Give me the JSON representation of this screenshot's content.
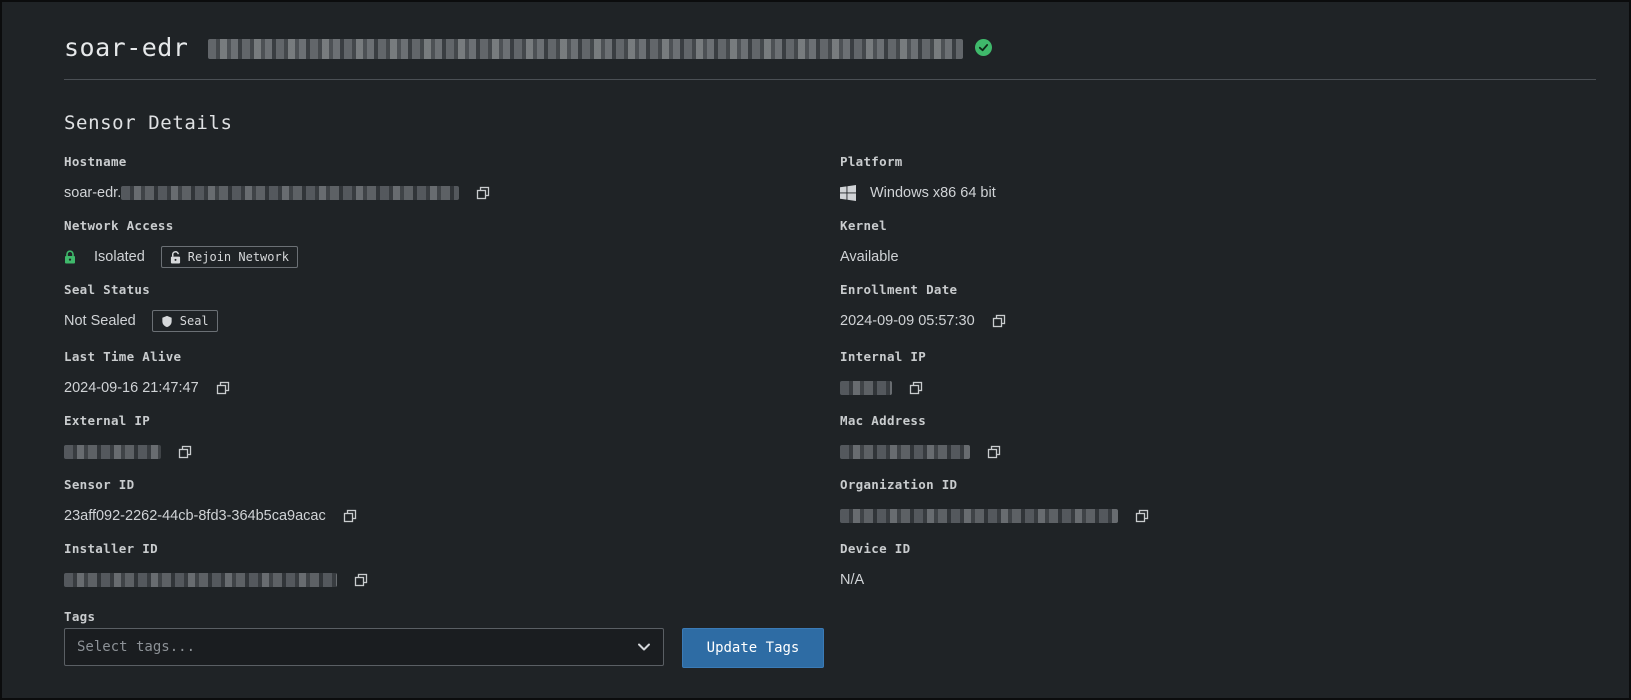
{
  "header": {
    "title_prefix": "soar-edr",
    "status": "online"
  },
  "section": {
    "title": "Sensor Details"
  },
  "left_fields": {
    "hostname": {
      "label": "Hostname",
      "value_prefix": "soar-edr."
    },
    "network_access": {
      "label": "Network Access",
      "value": "Isolated",
      "button_label": "Rejoin Network"
    },
    "seal_status": {
      "label": "Seal Status",
      "value": "Not Sealed",
      "button_label": "Seal"
    },
    "last_time_alive": {
      "label": "Last Time Alive",
      "value": "2024-09-16 21:47:47"
    },
    "external_ip": {
      "label": "External IP"
    },
    "sensor_id": {
      "label": "Sensor ID",
      "value": "23aff092-2262-44cb-8fd3-364b5ca9acac"
    },
    "installer_id": {
      "label": "Installer ID"
    }
  },
  "right_fields": {
    "platform": {
      "label": "Platform",
      "value": "Windows x86 64 bit",
      "icon": "windows-icon"
    },
    "kernel": {
      "label": "Kernel",
      "value": "Available"
    },
    "enrollment_date": {
      "label": "Enrollment Date",
      "value": "2024-09-09 05:57:30"
    },
    "internal_ip": {
      "label": "Internal IP"
    },
    "mac_address": {
      "label": "Mac Address"
    },
    "organization_id": {
      "label": "Organization ID"
    },
    "device_id": {
      "label": "Device ID",
      "value": "N/A"
    }
  },
  "tags": {
    "label": "Tags",
    "placeholder": "Select tags...",
    "update_button_label": "Update Tags"
  },
  "colors": {
    "background": "#1f2326",
    "accent_button": "#2e6ca4",
    "status_green": "#3fb96b"
  }
}
